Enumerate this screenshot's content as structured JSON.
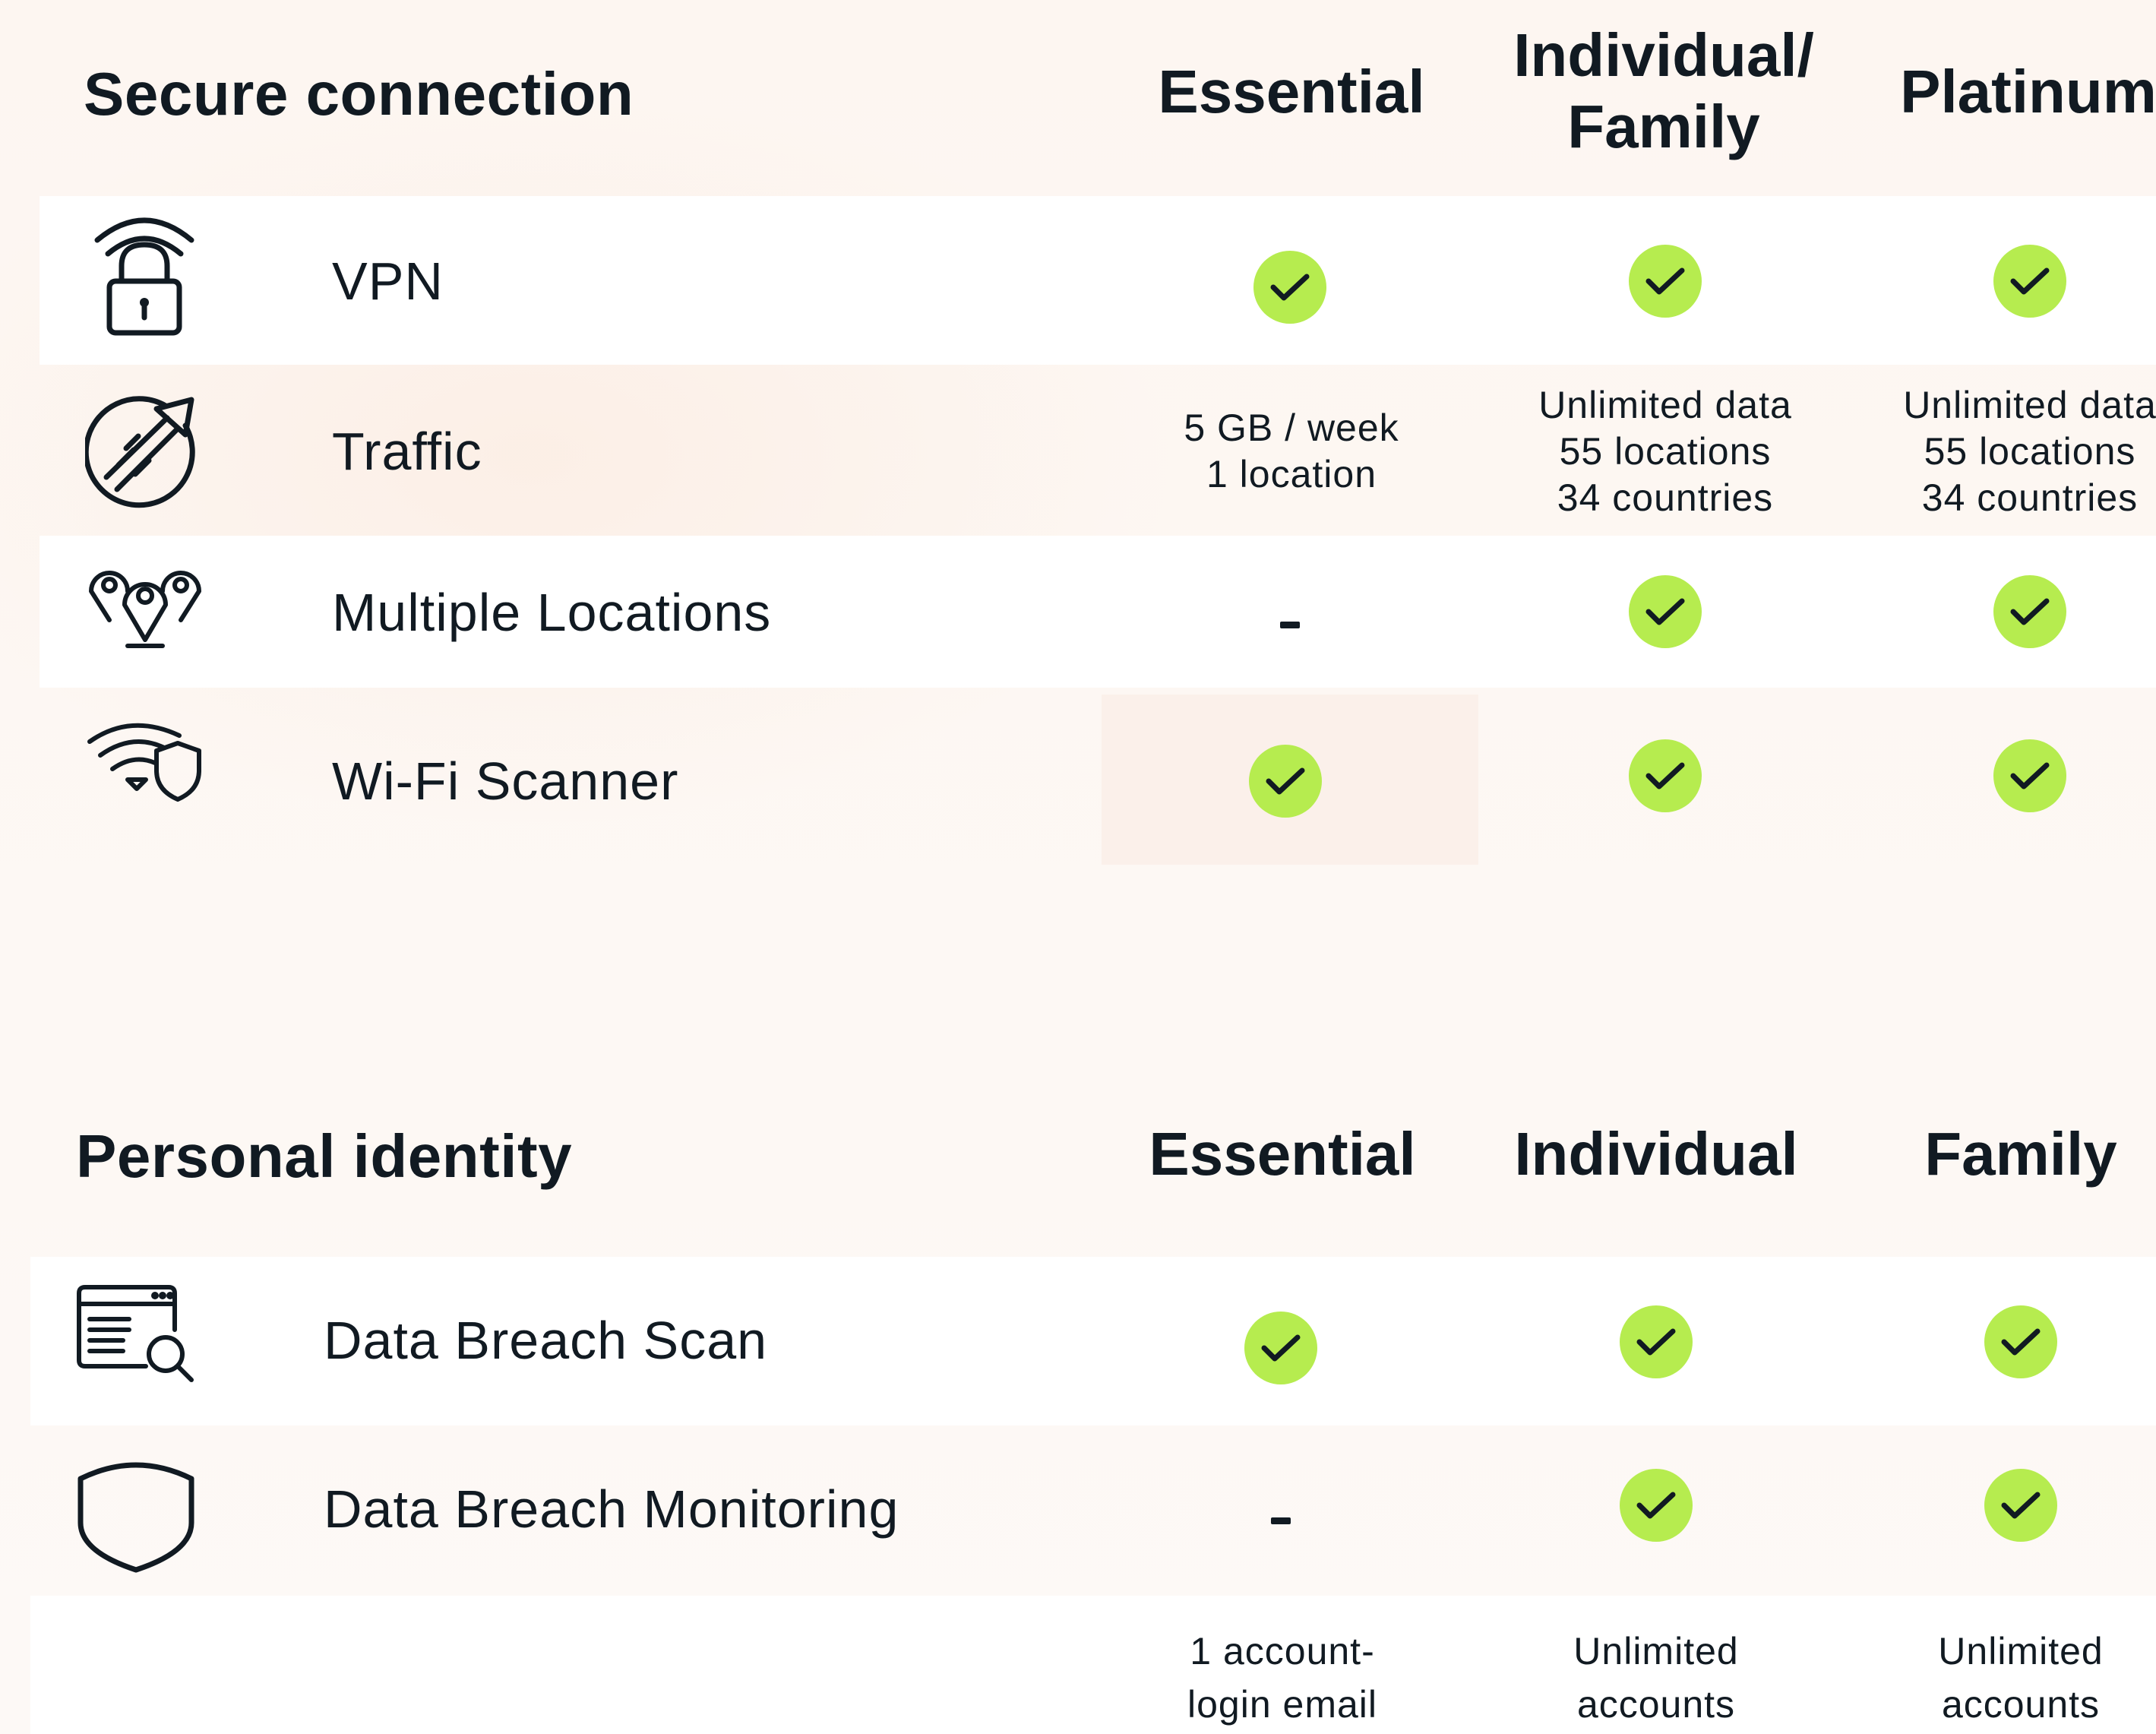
{
  "sections": [
    {
      "title": "Secure connection",
      "columns": [
        {
          "line1": "Essential",
          "line2": ""
        },
        {
          "line1": "Individual/",
          "line2": "Family"
        },
        {
          "line1": "Platinum",
          "line2": ""
        }
      ],
      "rows": [
        {
          "icon": "wifi-lock-icon",
          "label": "VPN",
          "cells": [
            {
              "type": "check"
            },
            {
              "type": "check"
            },
            {
              "type": "check"
            }
          ]
        },
        {
          "icon": "speed-arrow-icon",
          "label": "Traffic",
          "cells": [
            {
              "type": "text",
              "lines": [
                "5 GB / week",
                "1 location"
              ]
            },
            {
              "type": "text",
              "lines": [
                "Unlimited data",
                "55 locations",
                "34 countries"
              ]
            },
            {
              "type": "text",
              "lines": [
                "Unlimited data",
                "55 locations",
                "34 countries"
              ]
            }
          ]
        },
        {
          "icon": "location-pins-icon",
          "label": "Multiple Locations",
          "cells": [
            {
              "type": "dash"
            },
            {
              "type": "check"
            },
            {
              "type": "check"
            }
          ]
        },
        {
          "icon": "wifi-shield-icon",
          "label": "Wi-Fi Scanner",
          "cells": [
            {
              "type": "check"
            },
            {
              "type": "check"
            },
            {
              "type": "check"
            }
          ]
        }
      ]
    },
    {
      "title": "Personal identity",
      "columns": [
        {
          "line1": "Essential",
          "line2": ""
        },
        {
          "line1": "Individual",
          "line2": ""
        },
        {
          "line1": "Family",
          "line2": ""
        }
      ],
      "rows": [
        {
          "icon": "browser-search-icon",
          "label": "Data Breach Scan",
          "cells": [
            {
              "type": "check"
            },
            {
              "type": "check"
            },
            {
              "type": "check"
            }
          ]
        },
        {
          "icon": "shield-icon",
          "label": "Data Breach Monitoring",
          "cells": [
            {
              "type": "dash"
            },
            {
              "type": "check"
            },
            {
              "type": "check"
            }
          ]
        },
        {
          "icon": "",
          "label": "",
          "cells": [
            {
              "type": "text",
              "lines": [
                "1 account-",
                "login email"
              ]
            },
            {
              "type": "text",
              "lines": [
                "Unlimited",
                "accounts"
              ]
            },
            {
              "type": "text",
              "lines": [
                "Unlimited",
                "accounts"
              ]
            }
          ]
        }
      ]
    }
  ],
  "colors": {
    "check": "#b6ec4f",
    "ink": "#111a22",
    "row_white": "#ffffff"
  }
}
